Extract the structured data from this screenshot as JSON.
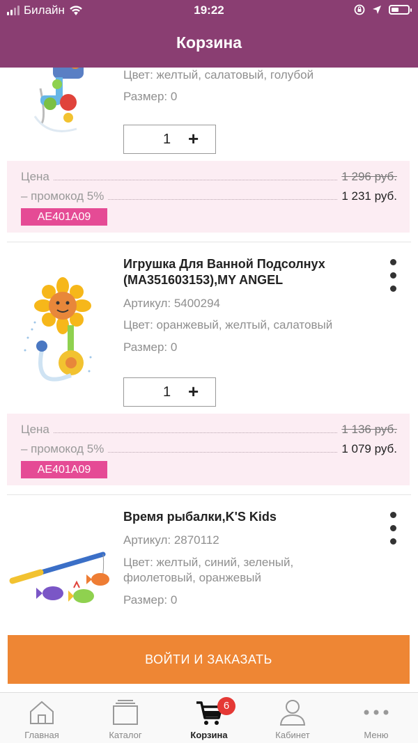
{
  "status_bar": {
    "carrier": "Билайн",
    "time": "19:22",
    "battery_level": 0.45
  },
  "header": {
    "title": "Корзина"
  },
  "items": [
    {
      "color": "Цвет: желтый, салатовый, голубой",
      "size": "Размер: 0",
      "qty": "1",
      "price_label": "Цена",
      "price_old": "1 296 руб.",
      "promo_label": "– промокод 5%",
      "price_new": "1 231 руб.",
      "promo_code": "AE401A09"
    },
    {
      "name": "Игрушка Для Ванной Подсолнух (MA351603153),MY ANGEL",
      "article": "Артикул: 5400294",
      "color": "Цвет: оранжевый, желтый, салатовый",
      "size": "Размер: 0",
      "qty": "1",
      "price_label": "Цена",
      "price_old": "1 136 руб.",
      "promo_label": "– промокод 5%",
      "price_new": "1 079 руб.",
      "promo_code": "AE401A09"
    },
    {
      "name": "Время рыбалки,K'S Kids",
      "article": "Артикул: 2870112",
      "color": "Цвет: желтый, синий, зеленый, фиолетовый, оранжевый",
      "size": "Размер: 0"
    }
  ],
  "cta": {
    "label": "ВОЙТИ И ЗАКАЗАТЬ"
  },
  "tabbar": {
    "tabs": [
      {
        "label": "Главная",
        "icon": "home-icon"
      },
      {
        "label": "Каталог",
        "icon": "catalog-icon"
      },
      {
        "label": "Корзина",
        "icon": "cart-icon",
        "badge": "6",
        "active": true
      },
      {
        "label": "Кабинет",
        "icon": "user-icon"
      },
      {
        "label": "Меню",
        "icon": "more-icon"
      }
    ]
  },
  "colors": {
    "header": "#8a3e72",
    "cta": "#ee8634",
    "promo": "#e54b95",
    "badge": "#e53935",
    "price_bg": "#fcedf3"
  }
}
